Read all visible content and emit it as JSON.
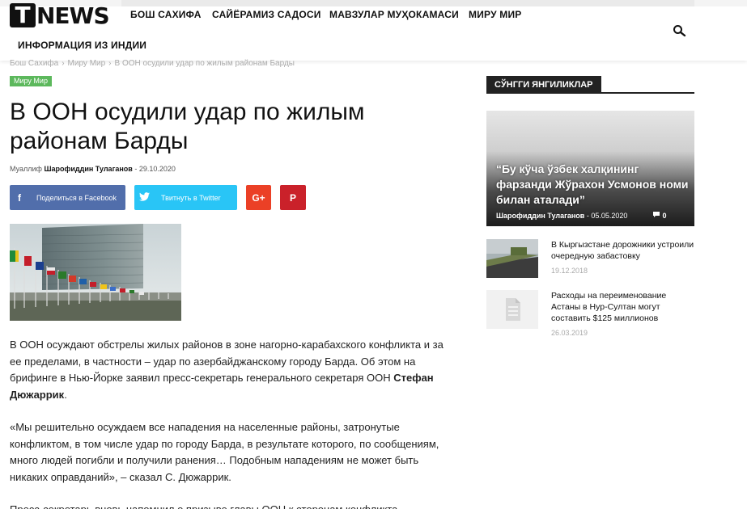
{
  "site": {
    "logo_letter": "T",
    "logo_text": "NEWS"
  },
  "nav": {
    "items": [
      {
        "label": "БОШ САХИФА"
      },
      {
        "label": "САЙЁРАМИЗ САДОСИ"
      },
      {
        "label": "МАВЗУЛАР МУҲОКАМАСИ"
      },
      {
        "label": "МИРУ МИР"
      },
      {
        "label": "ИНФОРМАЦИЯ ИЗ ИНДИИ"
      }
    ],
    "search_icon": "search-icon"
  },
  "breadcrumb": {
    "items": [
      "Бош Сахифа",
      "Миру Мир",
      "В ООН осудили удар по жилым районам Барды"
    ],
    "separator": "›"
  },
  "article": {
    "category": "Миру Мир",
    "title": "В ООН осудили удар по жилым районам Барды",
    "meta_label": "Муаллиф",
    "author": "Шарофиддин Тулаганов",
    "meta_separator": "-",
    "date": "29.10.2020",
    "share": {
      "facebook": "Поделиться в Facebook",
      "twitter": "Твитнуть в Twitter"
    },
    "paragraphs": [
      {
        "text": "В ООН осуждают обстрелы жилых районов в зоне нагорно-карабахского конфликта и за ее пределами, в частности – удар по азербайджанскому городу Барда. Об этом на брифинге в Нью-Йорке заявил пресс-секретарь генерального секретаря ООН ",
        "bold": "Стефан Дюжаррик",
        "end": "."
      },
      {
        "text": "«Мы решительно осуждаем все нападения на населенные районы, затронутые конфликтом, в том числе удар по городу Барда, в результате которого, по сообщениям, много людей погибли и получили ранения… Подобным нападениям не может быть никаких оправданий», – сказал С. Дюжаррик."
      },
      {
        "text": "Пресс-секретарь вновь напомнил о призыве главы ООН к сторонам конфликта"
      }
    ]
  },
  "sidebar": {
    "widget_title": "СЎНГГИ ЯНГИЛИКЛАР",
    "featured": {
      "title": "“Бу кўча ўзбек халқининг фарзанди Жўрахон Усмонов номи билан аталади”",
      "author": "Шарофиддин Тулаганов",
      "separator": "-",
      "date": "05.05.2020",
      "comments": "0"
    },
    "items": [
      {
        "title": "В Кыргызстане дорожники устроили очередную забастовку",
        "date": "19.12.2018"
      },
      {
        "title": "Расходы на переименование Астаны в Нур-Султан могут составить $125 миллионов",
        "date": "26.03.2019"
      }
    ]
  },
  "colors": {
    "facebook": "#516eab",
    "twitter": "#29c5f6",
    "google": "#eb4026",
    "pinterest": "#ca212a",
    "category": "#5cb85c"
  }
}
